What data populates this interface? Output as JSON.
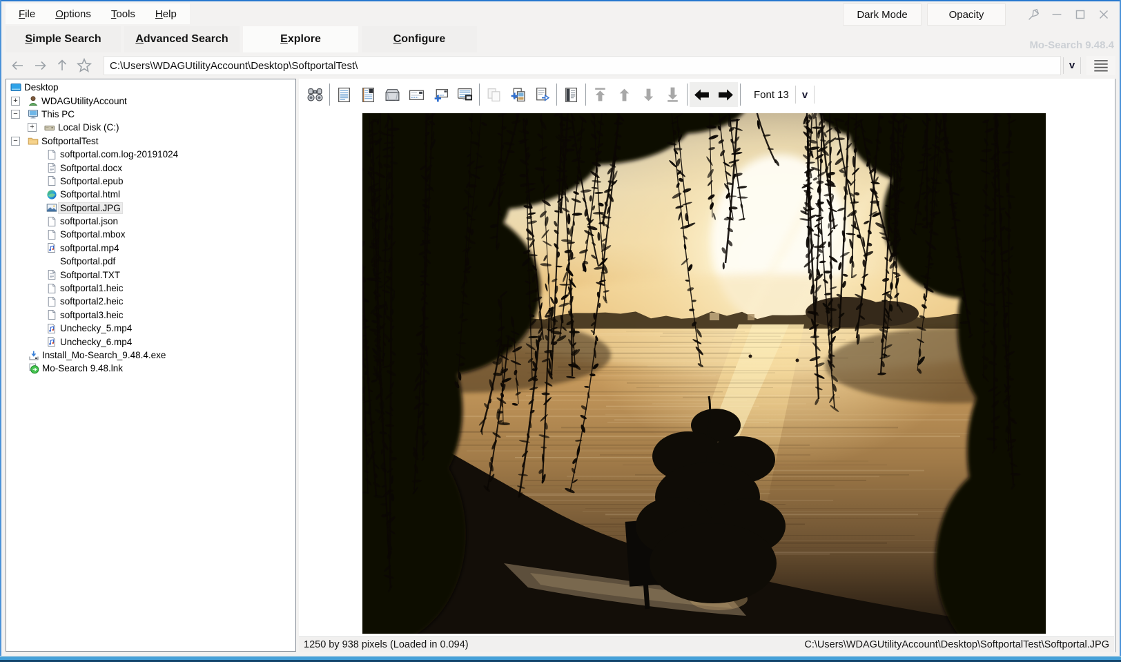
{
  "window": {
    "version_label": "Mo-Search 9.48.4",
    "accent_color": "#2e81d4",
    "frame_bottom_color": "#45a0d8"
  },
  "menubar": {
    "items": [
      {
        "label": "File"
      },
      {
        "label": "Options"
      },
      {
        "label": "Tools"
      },
      {
        "label": "Help"
      }
    ],
    "right_buttons": [
      {
        "label": "Dark Mode"
      },
      {
        "label": "Opacity"
      }
    ],
    "window_controls": [
      "pin-icon",
      "minimize-icon",
      "maximize-icon",
      "close-icon"
    ]
  },
  "tabs": {
    "items": [
      {
        "label": "Simple Search",
        "active": false
      },
      {
        "label": "Advanced Search",
        "active": false
      },
      {
        "label": "Explore",
        "active": true
      },
      {
        "label": "Configure",
        "active": false
      }
    ]
  },
  "addressbar": {
    "path": "C:\\Users\\WDAGUtilityAccount\\Desktop\\SoftportalTest\\",
    "dropdown_label": "v",
    "nav_icons": [
      "back-arrow-icon",
      "forward-arrow-icon",
      "up-arrow-icon",
      "favorite-star-icon",
      "hamburger-menu-icon"
    ]
  },
  "tree": {
    "items": [
      {
        "label": "Desktop",
        "level": 0,
        "icon": "desktop",
        "expander": null,
        "selected": false
      },
      {
        "label": "WDAGUtilityAccount",
        "level": 1,
        "icon": "user",
        "expander": "+",
        "selected": false
      },
      {
        "label": "This PC",
        "level": 1,
        "icon": "computer",
        "expander": "-",
        "selected": false
      },
      {
        "label": "Local Disk (C:)",
        "level": 2,
        "icon": "disk",
        "expander": "+",
        "selected": false
      },
      {
        "label": "SoftportalTest",
        "level": 1,
        "icon": "folder",
        "expander": "-",
        "selected": false
      },
      {
        "label": "softportal.com.log-20191024",
        "level": 2,
        "icon": "file",
        "expander": null,
        "selected": false
      },
      {
        "label": "Softportal.docx",
        "level": 2,
        "icon": "file-lines",
        "expander": null,
        "selected": false
      },
      {
        "label": "Softportal.epub",
        "level": 2,
        "icon": "file",
        "expander": null,
        "selected": false
      },
      {
        "label": "Softportal.html",
        "level": 2,
        "icon": "edge",
        "expander": null,
        "selected": false
      },
      {
        "label": "Softportal.JPG",
        "level": 2,
        "icon": "image",
        "expander": null,
        "selected": true
      },
      {
        "label": "softportal.json",
        "level": 2,
        "icon": "file",
        "expander": null,
        "selected": false
      },
      {
        "label": "Softportal.mbox",
        "level": 2,
        "icon": "file",
        "expander": null,
        "selected": false
      },
      {
        "label": "softportal.mp4",
        "level": 2,
        "icon": "media",
        "expander": null,
        "selected": false
      },
      {
        "label": "Softportal.pdf",
        "level": 2,
        "icon": "none",
        "expander": null,
        "selected": false
      },
      {
        "label": "Softportal.TXT",
        "level": 2,
        "icon": "file-lines",
        "expander": null,
        "selected": false
      },
      {
        "label": "softportal1.heic",
        "level": 2,
        "icon": "file",
        "expander": null,
        "selected": false
      },
      {
        "label": "softportal2.heic",
        "level": 2,
        "icon": "file",
        "expander": null,
        "selected": false
      },
      {
        "label": "softportal3.heic",
        "level": 2,
        "icon": "file",
        "expander": null,
        "selected": false
      },
      {
        "label": "Unchecky_5.mp4",
        "level": 2,
        "icon": "media",
        "expander": null,
        "selected": false
      },
      {
        "label": "Unchecky_6.mp4",
        "level": 2,
        "icon": "media",
        "expander": null,
        "selected": false
      },
      {
        "label": "Install_Mo-Search_9.48.4.exe",
        "level": 1,
        "icon": "installer",
        "expander": null,
        "selected": false
      },
      {
        "label": "Mo-Search 9.48.lnk",
        "level": 1,
        "icon": "app-link",
        "expander": null,
        "selected": false
      }
    ]
  },
  "toolbar": {
    "buttons": [
      {
        "name": "search-button",
        "icon": "binoculars"
      },
      {
        "separator": true
      },
      {
        "name": "view-document-button",
        "icon": "doc"
      },
      {
        "name": "view-book-button",
        "icon": "book"
      },
      {
        "name": "open-folder-button",
        "icon": "folder"
      },
      {
        "name": "email-button",
        "icon": "envelope"
      },
      {
        "name": "new-email-button",
        "icon": "envelope-plus"
      },
      {
        "name": "email-computer-button",
        "icon": "computer-envelope"
      },
      {
        "separator": true
      },
      {
        "name": "copy-button",
        "icon": "copy",
        "disabled": true
      },
      {
        "name": "copy-add-button",
        "icon": "copy-plus"
      },
      {
        "name": "export-document-button",
        "icon": "export"
      },
      {
        "separator": true
      },
      {
        "name": "view-report-button",
        "icon": "report"
      },
      {
        "separator": true
      },
      {
        "name": "first-item-button",
        "icon": "first"
      },
      {
        "name": "previous-item-button",
        "icon": "prev"
      },
      {
        "name": "next-item-button",
        "icon": "next"
      },
      {
        "name": "last-item-button",
        "icon": "last"
      },
      {
        "separator": true
      },
      {
        "name": "previous-file-button",
        "icon": "back"
      },
      {
        "name": "next-file-button",
        "icon": "forward"
      },
      {
        "separator": true
      }
    ],
    "font_label": "Font 13",
    "font_dropdown_label": "v"
  },
  "preview": {
    "description": "Sunset over a lake framed by weeping willow branches"
  },
  "statusbar": {
    "left": "1250 by 938 pixels (Loaded in 0.094)",
    "right": "C:\\Users\\WDAGUtilityAccount\\Desktop\\SoftportalTest\\Softportal.JPG"
  }
}
